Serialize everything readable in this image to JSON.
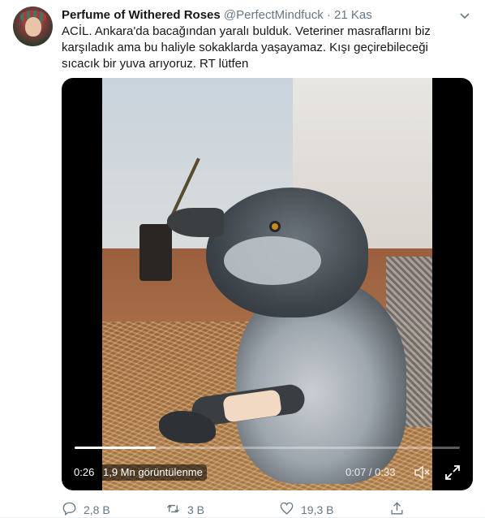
{
  "tweet": {
    "author_name": "Perfume of Withered Roses",
    "author_handle": "@PerfectMindfuck",
    "separator": "·",
    "time": "21 Kas",
    "text": "ACİL. Ankara'da bacağından yaralı bulduk. Veteriner masraflarını biz karşıladık ama bu haliyle sokaklarda yaşayamaz. Kışı geçirebileceği sıcacık bir yuva arıyoruz. RT lütfen"
  },
  "video": {
    "duration": "0:26",
    "views": "1,9 Mn görüntülenme",
    "timecode": "0:07 / 0:33",
    "progress": 0.21
  },
  "actions": {
    "replies": "2,8 B",
    "retweets": "3 B",
    "likes": "19,3 B"
  },
  "icons": {
    "caret": "chevron-down-icon",
    "reply": "reply-icon",
    "retweet": "retweet-icon",
    "like": "heart-icon",
    "share": "share-icon",
    "mute": "speaker-muted-icon",
    "fullscreen": "fullscreen-icon"
  },
  "colors": {
    "text": "#14171a",
    "secondary": "#657786",
    "accent": "#1da1f2"
  }
}
